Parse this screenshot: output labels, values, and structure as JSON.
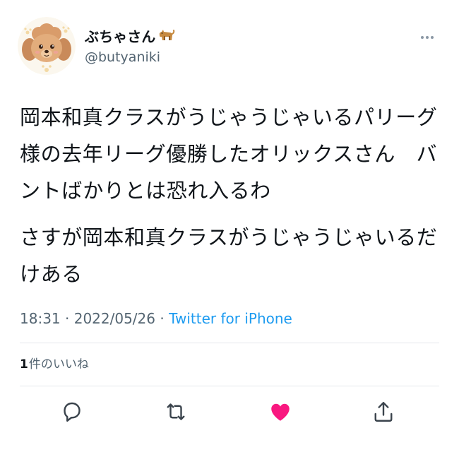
{
  "author": {
    "display_name": "ぶちゃさん",
    "name_emoji": "dog-emoji",
    "handle": "@butyaniki",
    "avatar": "toy-poodle-illustration"
  },
  "tweet": {
    "paragraphs": [
      "岡本和真クラスがうじゃうじゃいるパリーグ様の去年リーグ優勝したオリックスさん　バントばかりとは恐れ入るわ",
      "さすが岡本和真クラスがうじゃうじゃいるだけある"
    ],
    "time": "18:31",
    "date": "2022/05/26",
    "separator": "·",
    "source": "Twitter for iPhone"
  },
  "likes": {
    "count": "1",
    "label": "件のいいね"
  },
  "actions": [
    {
      "name": "reply",
      "icon": "reply-icon"
    },
    {
      "name": "retweet",
      "icon": "retweet-icon"
    },
    {
      "name": "like",
      "icon": "heart-icon",
      "liked": true
    },
    {
      "name": "share",
      "icon": "share-icon"
    }
  ],
  "colors": {
    "text": "#0f1419",
    "secondary": "#536471",
    "link": "#1d9bf0",
    "like": "#f91880",
    "divider": "#e4e8eb"
  }
}
